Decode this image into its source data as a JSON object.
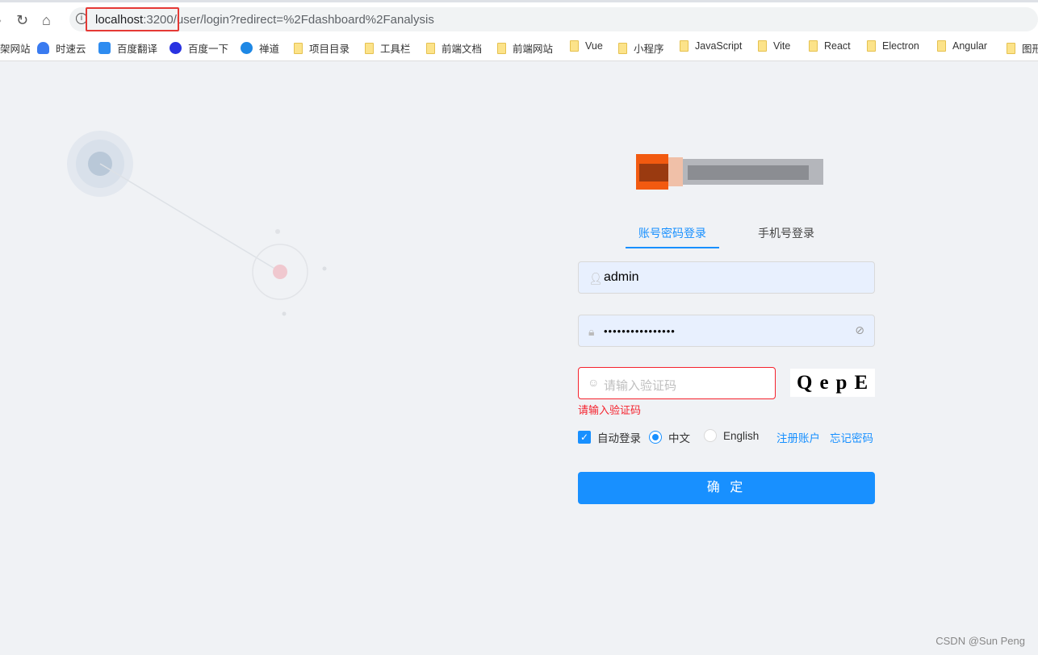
{
  "browser": {
    "url_host": "localhost",
    "url_rest": ":3200/user/login?redirect=%2Fdashboard%2Fanalysis",
    "bookmarks": [
      "架网站",
      "时速云",
      "百度翻译",
      "百度一下",
      "禅道",
      "项目目录",
      "工具栏",
      "前端文档",
      "前端网站",
      "Vue",
      "小程序",
      "JavaScript",
      "Vite",
      "React",
      "Electron",
      "Angular",
      "图形"
    ]
  },
  "login": {
    "tabs": [
      "账号密码登录",
      "手机号登录"
    ],
    "username": "admin",
    "password_mask": "••••••••••••••••",
    "captcha_placeholder": "请输入验证码",
    "captcha_text": "QepE",
    "captcha_error": "请输入验证码",
    "auto_login": "自动登录",
    "lang_zh": "中文",
    "lang_en": "English",
    "register": "注册账户",
    "forgot": "忘记密码",
    "submit": "确 定"
  },
  "watermark": "CSDN @Sun  Peng",
  "colors": {
    "primary": "#1890ff",
    "error": "#f5222d",
    "background": "#f0f2f5"
  }
}
